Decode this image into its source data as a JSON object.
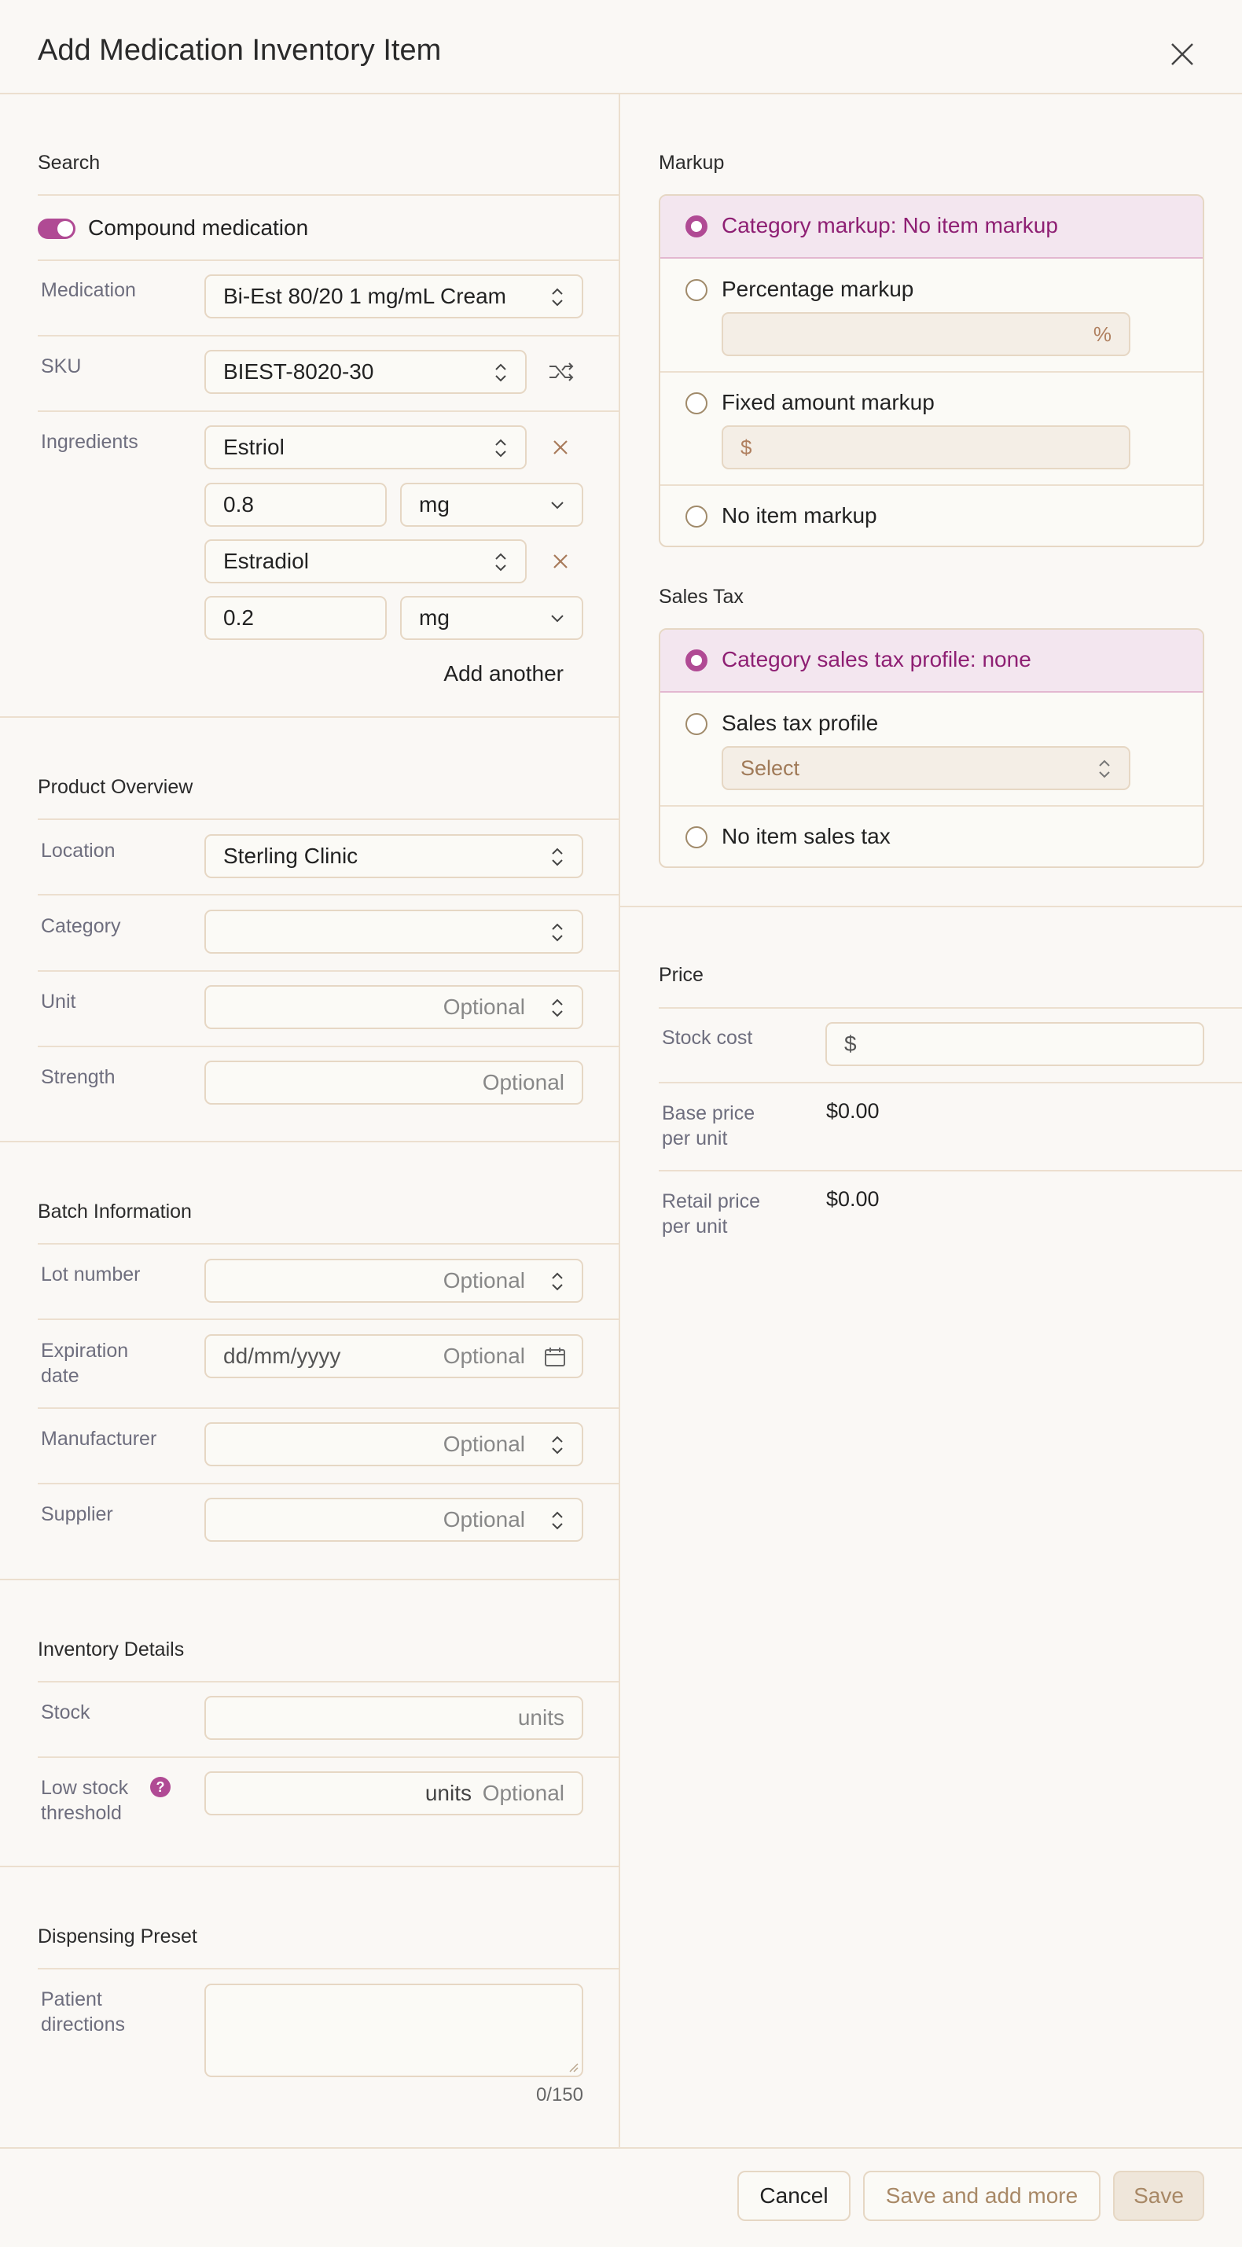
{
  "dialog": {
    "title": "Add Medication Inventory Item"
  },
  "icons": {
    "close": "close-icon",
    "shuffle": "shuffle-icon",
    "remove": "x-icon",
    "calendar": "calendar-icon",
    "help": "question-icon",
    "chevron_updown": "chevron-updown-icon",
    "chevron_down": "chevron-down-icon"
  },
  "colors": {
    "accent": "#b04a94",
    "accent_text": "#8e1f73",
    "border": "#e6d7c4",
    "background": "#faf8f5"
  },
  "search": {
    "title": "Search",
    "compound_toggle_label": "Compound medication",
    "compound_on": true,
    "medication_label": "Medication",
    "medication_value": "Bi-Est 80/20 1 mg/mL Cream",
    "sku_label": "SKU",
    "sku_value": "BIEST-8020-30",
    "ingredients_label": "Ingredients",
    "ingredients": [
      {
        "name": "Estriol",
        "amount": "0.8",
        "unit": "mg"
      },
      {
        "name": "Estradiol",
        "amount": "0.2",
        "unit": "mg"
      }
    ],
    "add_another": "Add another"
  },
  "product_overview": {
    "title": "Product Overview",
    "location_label": "Location",
    "location_value": "Sterling Clinic",
    "category_label": "Category",
    "unit_label": "Unit",
    "unit_placeholder": "Optional",
    "strength_label": "Strength",
    "strength_placeholder": "Optional"
  },
  "batch": {
    "title": "Batch Information",
    "lot_label": "Lot number",
    "lot_placeholder": "Optional",
    "expiration_label_1": "Expiration",
    "expiration_label_2": "date",
    "expiration_format": "dd/mm/yyyy",
    "expiration_placeholder": "Optional",
    "manufacturer_label": "Manufacturer",
    "manufacturer_placeholder": "Optional",
    "supplier_label": "Supplier",
    "supplier_placeholder": "Optional"
  },
  "inventory": {
    "title": "Inventory Details",
    "stock_label": "Stock",
    "stock_unit": "units",
    "low_stock_label_1": "Low stock",
    "low_stock_label_2": "threshold",
    "low_stock_unit": "units",
    "low_stock_placeholder": "Optional",
    "help_glyph": "?"
  },
  "dispensing": {
    "title": "Dispensing Preset",
    "directions_label_1": "Patient",
    "directions_label_2": "directions",
    "counter": "0/150"
  },
  "markup": {
    "title": "Markup",
    "options": [
      "Category markup: No item markup",
      "Percentage markup",
      "Fixed amount markup",
      "No item markup"
    ],
    "selected": 0,
    "percent_symbol": "%",
    "dollar_symbol": "$"
  },
  "sales_tax": {
    "title": "Sales Tax",
    "options": [
      "Category sales tax profile: none",
      "Sales tax profile",
      "No item sales tax"
    ],
    "selected": 0,
    "profile_placeholder": "Select"
  },
  "price": {
    "title": "Price",
    "stock_cost_label": "Stock cost",
    "stock_cost_symbol": "$",
    "base_label_1": "Base price",
    "base_label_2": "per unit",
    "base_value": "$0.00",
    "retail_label_1": "Retail price",
    "retail_label_2": "per unit",
    "retail_value": "$0.00"
  },
  "footer": {
    "cancel": "Cancel",
    "save_more": "Save and add more",
    "save": "Save"
  }
}
